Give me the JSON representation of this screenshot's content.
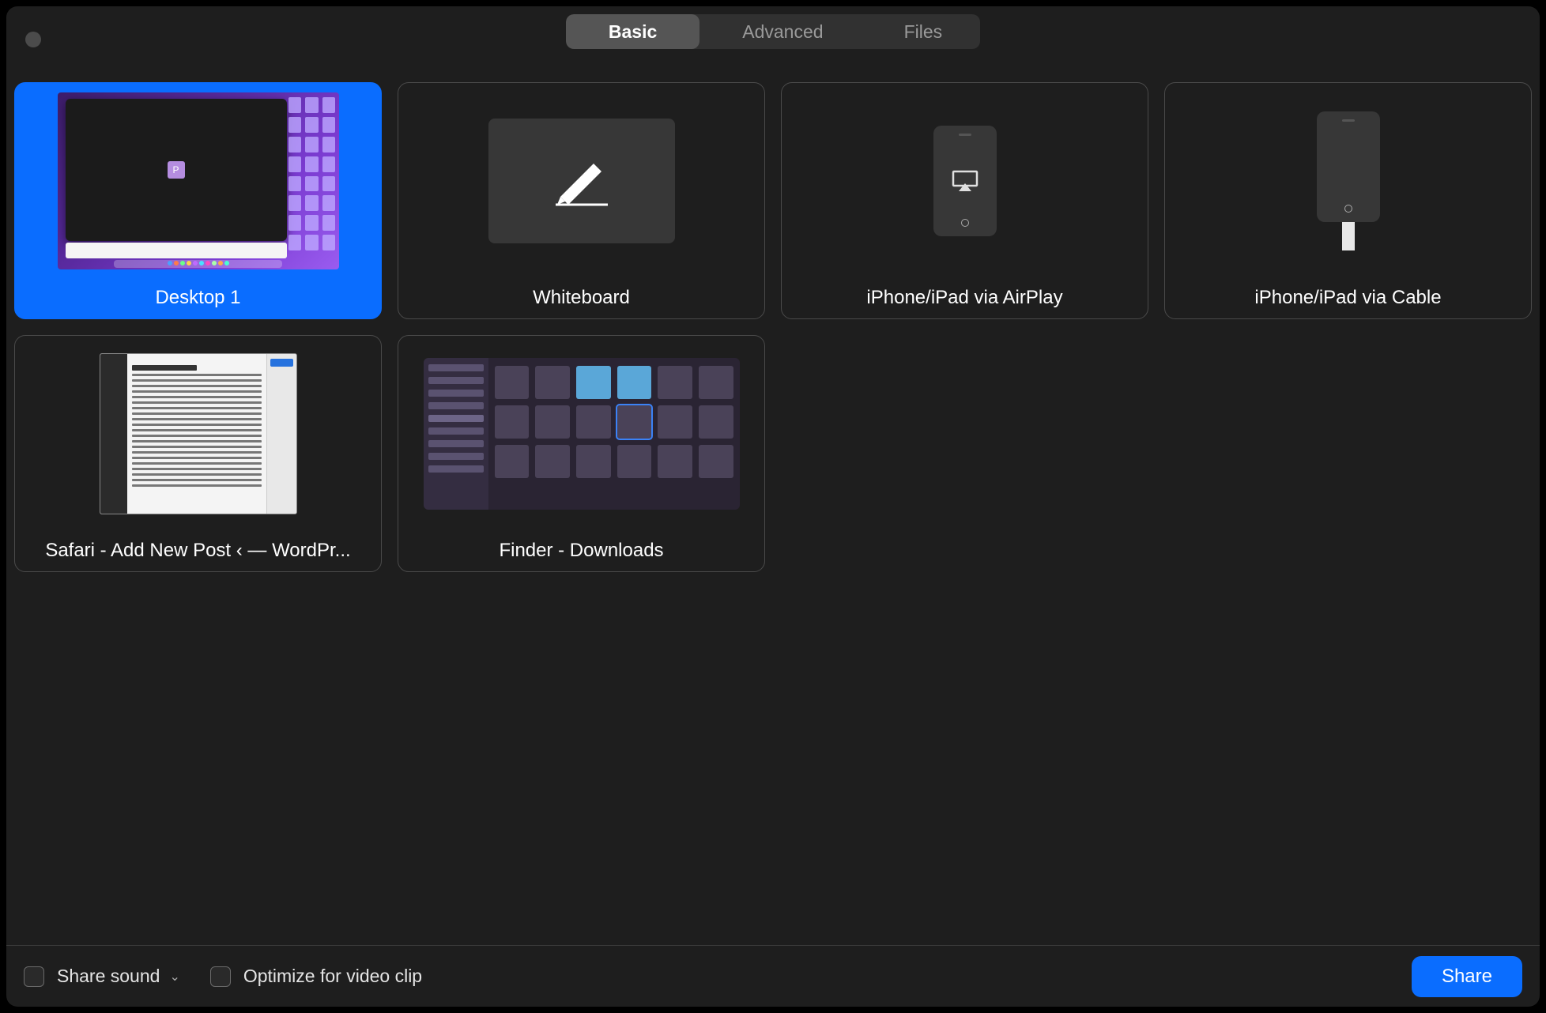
{
  "tabs": {
    "basic": "Basic",
    "advanced": "Advanced",
    "files": "Files",
    "active": "basic"
  },
  "options": [
    {
      "id": "desktop-1",
      "label": "Desktop 1",
      "selected": true
    },
    {
      "id": "whiteboard",
      "label": "Whiteboard",
      "selected": false
    },
    {
      "id": "airplay",
      "label": "iPhone/iPad via AirPlay",
      "selected": false
    },
    {
      "id": "cable",
      "label": "iPhone/iPad via Cable",
      "selected": false
    },
    {
      "id": "safari",
      "label": "Safari - Add New Post ‹ — WordPr...",
      "selected": false
    },
    {
      "id": "finder",
      "label": "Finder - Downloads",
      "selected": false
    }
  ],
  "footer": {
    "share_sound": "Share sound",
    "optimize": "Optimize for video clip",
    "share_button": "Share"
  }
}
